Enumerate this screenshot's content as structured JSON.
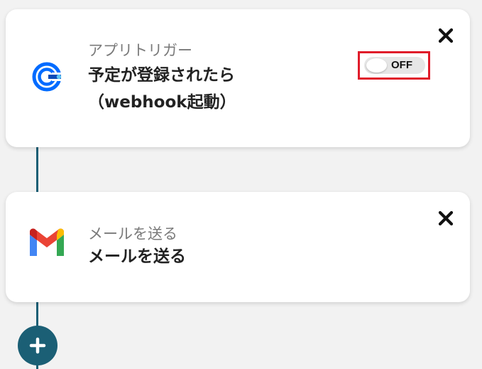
{
  "flow": {
    "steps": [
      {
        "subtitle": "アプリトリガー",
        "title": "予定が登録されたら\n（webhook起動）",
        "icon": "calendly-icon",
        "toggle": {
          "label": "OFF",
          "state": "off"
        },
        "close_icon": "close-icon"
      },
      {
        "subtitle": "メールを送る",
        "title": "メールを送る",
        "icon": "gmail-icon",
        "close_icon": "close-icon"
      }
    ],
    "add_icon": "plus-icon"
  },
  "colors": {
    "background": "#f2f2f2",
    "connector": "#1b5f75",
    "add_button": "#1b5f75",
    "highlight": "#e01b2a",
    "calendly_blue": "#006bff",
    "gmail_red": "#ea4335",
    "gmail_blue": "#4285f4",
    "gmail_green": "#34a853",
    "gmail_yellow": "#fbbc04"
  }
}
